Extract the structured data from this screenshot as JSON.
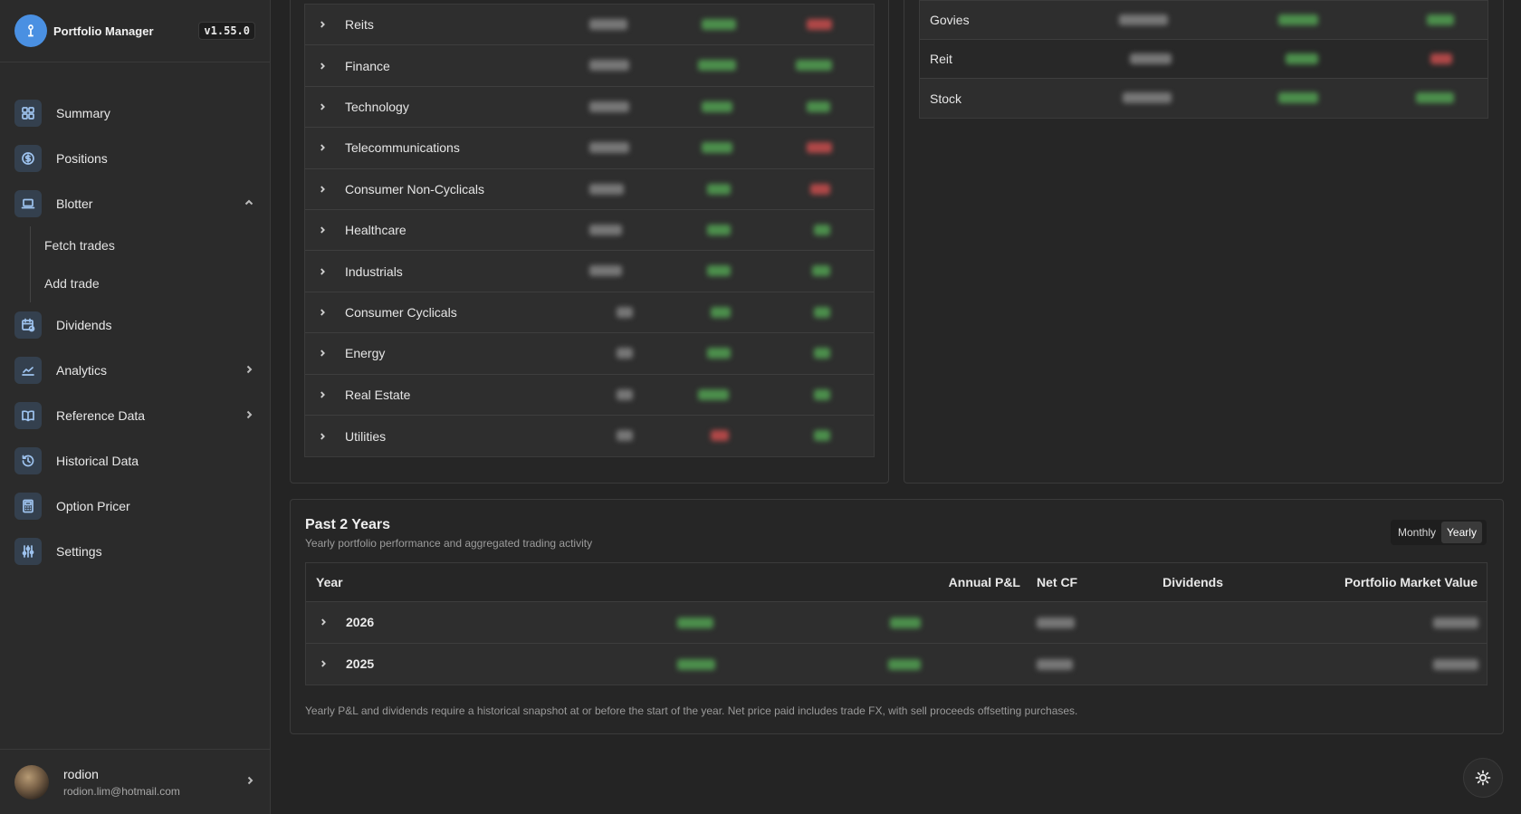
{
  "app": {
    "name": "Portfolio Manager",
    "version": "v1.55.0"
  },
  "colors": {
    "accent": "#4a90e2",
    "positive": "#4caf50",
    "negative": "#e05252",
    "neutral": "#9a9a9a"
  },
  "nav": {
    "summary": "Summary",
    "positions": "Positions",
    "blotter": "Blotter",
    "fetch_trades": "Fetch trades",
    "add_trade": "Add trade",
    "dividends": "Dividends",
    "analytics": "Analytics",
    "reference_data": "Reference Data",
    "historical_data": "Historical Data",
    "option_pricer": "Option Pricer",
    "settings": "Settings"
  },
  "user": {
    "name": "rodion",
    "email": "rodion.lim@hotmail.com"
  },
  "sectors": [
    {
      "name": "Reits"
    },
    {
      "name": "Finance"
    },
    {
      "name": "Technology"
    },
    {
      "name": "Telecommunications"
    },
    {
      "name": "Consumer Non-Cyclicals"
    },
    {
      "name": "Healthcare"
    },
    {
      "name": "Industrials"
    },
    {
      "name": "Consumer Cyclicals"
    },
    {
      "name": "Energy"
    },
    {
      "name": "Real Estate"
    },
    {
      "name": "Utilities"
    }
  ],
  "asset_classes": [
    {
      "name": "Govies"
    },
    {
      "name": "Reit"
    },
    {
      "name": "Stock"
    }
  ],
  "past": {
    "title": "Past 2 Years",
    "subtitle": "Yearly portfolio performance and aggregated trading activity",
    "toggle": {
      "monthly": "Monthly",
      "yearly": "Yearly"
    },
    "columns": {
      "year": "Year",
      "annual_pnl": "Annual P&L",
      "dividends": "Dividends",
      "net_cf": "Net CF",
      "market_value": "Portfolio Market Value"
    },
    "years": [
      "2026",
      "2025"
    ],
    "note": "Yearly P&L and dividends require a historical snapshot at or before the start of the year. Net price paid includes trade FX, with sell proceeds offsetting purchases."
  }
}
